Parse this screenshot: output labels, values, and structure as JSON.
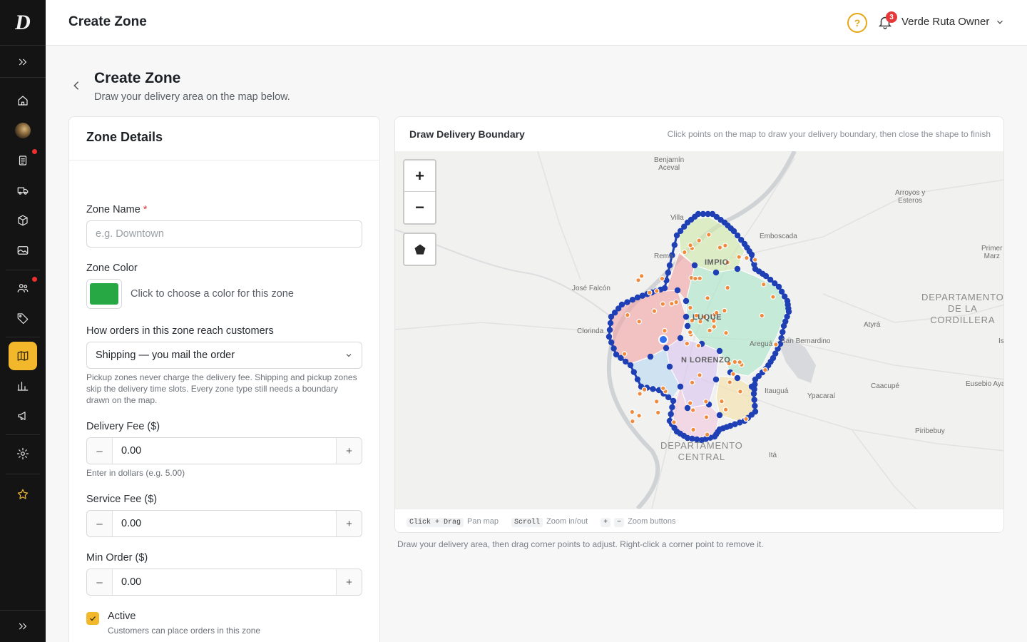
{
  "app": {
    "logo_glyph": "D",
    "header_title": "Create Zone",
    "notifications_count": "3",
    "user_name": "Verde Ruta Owner"
  },
  "page": {
    "title": "Create Zone",
    "subtitle": "Draw your delivery area on the map below."
  },
  "sidebar": {
    "items": [
      {
        "name": "home-icon"
      },
      {
        "name": "avatar"
      },
      {
        "name": "orders-icon",
        "dot": true
      },
      {
        "name": "truck-icon"
      },
      {
        "name": "box-icon"
      },
      {
        "name": "image-icon"
      },
      {
        "name": "users-icon",
        "dot": true
      },
      {
        "name": "tag-icon"
      },
      {
        "name": "map-icon",
        "active": true
      },
      {
        "name": "chart-icon"
      },
      {
        "name": "megaphone-icon"
      },
      {
        "name": "gear-icon"
      },
      {
        "name": "star-icon"
      }
    ]
  },
  "form": {
    "panel_title": "Zone Details",
    "zone_name": {
      "label": "Zone Name",
      "required_mark": "*",
      "value": "",
      "placeholder": "e.g. Downtown"
    },
    "zone_color": {
      "label": "Zone Color",
      "value": "#27a844",
      "hint": "Click to choose a color for this zone"
    },
    "order_method": {
      "label": "How orders in this zone reach customers",
      "selected": "Shipping — you mail the order",
      "help": "Pickup zones never charge the delivery fee. Shipping and pickup zones skip the delivery time slots. Every zone type still needs a boundary drawn on the map."
    },
    "delivery_fee": {
      "label": "Delivery Fee ($)",
      "value": "0.00",
      "help": "Enter in dollars (e.g. 5.00)",
      "minus": "–",
      "plus": "+"
    },
    "service_fee": {
      "label": "Service Fee ($)",
      "value": "0.00",
      "minus": "–",
      "plus": "+"
    },
    "min_order": {
      "label": "Min Order ($)",
      "value": "0.00",
      "minus": "–",
      "plus": "+"
    },
    "active": {
      "label": "Active",
      "checked": true,
      "help": "Customers can place orders in this zone"
    }
  },
  "map": {
    "title": "Draw Delivery Boundary",
    "hint": "Click points on the map to draw your delivery boundary, then close the shape to finish",
    "zoom_in": "+",
    "zoom_out": "−",
    "labels": {
      "benjamin_aceval": "Benjamín\nAceval",
      "arroyos_esteros": "Arroyos y\nEsteros",
      "villa": "Villa",
      "emboscada": "Emboscada",
      "primer_marzo": "Primer\nMarz",
      "remansito": "Rema",
      "limpio": "IMPIO",
      "jose_falcon": "José Falcón",
      "dep_cordillera": "DEPARTAMENTO\nDE LA\nCORDILLERA",
      "clorinda": "Clorinda",
      "luque": "LUQUE",
      "atyra": "Atyrá",
      "isla": "Is",
      "aregua": "Areguá",
      "san_bernardino": "San Bernardino",
      "san_lorenzo": "N LORENZO",
      "itaugua": "Itauguá",
      "ypacarai": "Ypacaraí",
      "caacupe": "Caacupé",
      "eusebio_ayala": "Eusebio Ayal",
      "piribebuy": "Piribebuy",
      "dep_central": "DEPARTAMENTO\nCENTRAL",
      "ita": "Itá"
    },
    "footer": {
      "pan_key": "Click + Drag",
      "pan_text": "Pan map",
      "zoom_key": "Scroll",
      "zoom_text": "Zoom in/out",
      "plus_key": "+",
      "minus_key": "−",
      "buttons_text": "Zoom buttons"
    },
    "zone_colors": [
      "#f4a3a3",
      "#b9d9f2",
      "#cfe9a8",
      "#a8e6c6",
      "#d8c4f0",
      "#f6e2a6",
      "#f3c6dc"
    ],
    "boundary_color": "#1f3fb5",
    "marker_color": "#f08a3c"
  },
  "below_map_note": "Draw your delivery area, then drag corner points to adjust. Right-click a corner point to remove it."
}
